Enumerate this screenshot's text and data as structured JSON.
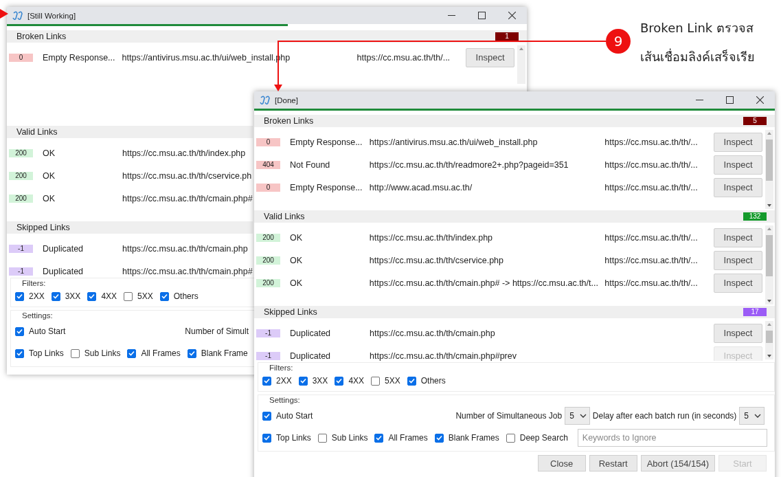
{
  "callout": {
    "number": "9",
    "lines": [
      "Broken Link ตรวจส",
      "เส้นเชื่อมลิงค์เสร็จเรีย"
    ]
  },
  "windows": [
    {
      "title": "[Still Working]",
      "progress": {
        "level": 0.54
      },
      "sections": [
        {
          "kind": "broken",
          "title": "Broken Links",
          "count": "1",
          "rows": [
            {
              "code": "0",
              "status": "Empty Response...",
              "url": "https://antivirus.msu.ac.th/ui/web_install.php",
              "referrer": "https://cc.msu.ac.th/th/...",
              "inspect": {
                "label": "Inspect",
                "disabled": false
              }
            }
          ]
        },
        {
          "kind": "valid",
          "title": "Valid Links",
          "rows": [
            {
              "code": "200",
              "status": "OK",
              "url": "https://cc.msu.ac.th/th/index.php"
            },
            {
              "code": "200",
              "status": "OK",
              "url": "https://cc.msu.ac.th/th/cservice.ph"
            },
            {
              "code": "200",
              "status": "OK",
              "url": "https://cc.msu.ac.th/th/cmain.php#"
            }
          ]
        },
        {
          "kind": "skipped",
          "title": "Skipped Links",
          "rows": [
            {
              "code": "-1",
              "status": "Duplicated",
              "url": "https://cc.msu.ac.th/th/cmain.php"
            },
            {
              "code": "-1",
              "status": "Duplicated",
              "url": "https://cc.msu.ac.th/th/cmain.php#"
            }
          ]
        }
      ],
      "filters": {
        "legend": "Filters:",
        "items": [
          {
            "label": "2XX",
            "checked": true
          },
          {
            "label": "3XX",
            "checked": true
          },
          {
            "label": "4XX",
            "checked": true
          },
          {
            "label": "5XX",
            "checked": false
          },
          {
            "label": "Others",
            "checked": true
          }
        ]
      },
      "settings": {
        "legend": "Settings:",
        "first_line": [
          {
            "kind": "checkbox",
            "label": "Auto Start",
            "checked": true
          },
          {
            "kind": "text",
            "label": "Number of Simult"
          }
        ],
        "second_line": [
          {
            "kind": "checkbox",
            "label": "Top Links",
            "checked": true
          },
          {
            "kind": "checkbox",
            "label": "Sub Links",
            "checked": false
          },
          {
            "kind": "checkbox",
            "label": "All Frames",
            "checked": true
          },
          {
            "kind": "checkbox",
            "label": "Blank Frame",
            "checked": true
          }
        ]
      }
    },
    {
      "title": "[Done]",
      "progress": {
        "level": 1
      },
      "sections": [
        {
          "kind": "broken",
          "title": "Broken Links",
          "count": "5",
          "rows": [
            {
              "code": "0",
              "status": "Empty Response...",
              "url": "https://antivirus.msu.ac.th/ui/web_install.php",
              "referrer": "https://cc.msu.ac.th/th/...",
              "inspect": {
                "label": "Inspect",
                "disabled": false
              }
            },
            {
              "code": "404",
              "status": "Not Found",
              "url": "https://cc.msu.ac.th/th/readmore2+.php?pageid=351",
              "referrer": "https://cc.msu.ac.th/th/...",
              "inspect": {
                "label": "Inspect",
                "disabled": false
              }
            },
            {
              "code": "0",
              "status": "Empty Response...",
              "url": "http://www.acad.msu.ac.th/",
              "referrer": "https://cc.msu.ac.th/th/...",
              "inspect": {
                "label": "Inspect",
                "disabled": false
              }
            }
          ]
        },
        {
          "kind": "valid",
          "title": "Valid Links",
          "count": "132",
          "rows": [
            {
              "code": "200",
              "status": "OK",
              "url": "https://cc.msu.ac.th/th/index.php",
              "referrer": "https://cc.msu.ac.th/th/...",
              "inspect": {
                "label": "Inspect",
                "disabled": false
              }
            },
            {
              "code": "200",
              "status": "OK",
              "url": "https://cc.msu.ac.th/th/cservice.php",
              "referrer": "https://cc.msu.ac.th/th/...",
              "inspect": {
                "label": "Inspect",
                "disabled": false
              }
            },
            {
              "code": "200",
              "status": "OK",
              "url": "https://cc.msu.ac.th/th/cmain.php# -> https://cc.msu.ac.th/t...",
              "referrer": "https://cc.msu.ac.th/th/...",
              "inspect": {
                "label": "Inspect",
                "disabled": false
              }
            }
          ]
        },
        {
          "kind": "skipped",
          "title": "Skipped Links",
          "count": "17",
          "rows": [
            {
              "code": "-1",
              "status": "Duplicated",
              "url": "https://cc.msu.ac.th/th/cmain.php",
              "inspect": {
                "label": "Inspect",
                "disabled": false
              }
            },
            {
              "code": "-1",
              "status": "Duplicated",
              "url": "https://cc.msu.ac.th/th/cmain.php#prev",
              "inspect": {
                "label": "Inspect",
                "disabled": true
              }
            }
          ]
        }
      ],
      "filters": {
        "legend": "Filters:",
        "items": [
          {
            "label": "2XX",
            "checked": true
          },
          {
            "label": "3XX",
            "checked": true
          },
          {
            "label": "4XX",
            "checked": true
          },
          {
            "label": "5XX",
            "checked": false
          },
          {
            "label": "Others",
            "checked": true
          }
        ]
      },
      "settings": {
        "legend": "Settings:",
        "first_line": [
          {
            "kind": "checkbox",
            "label": "Auto Start",
            "checked": true
          },
          {
            "kind": "select",
            "label": "Number of Simultaneous Job",
            "value": "5"
          },
          {
            "kind": "select",
            "label": "Delay after each batch run (in seconds)",
            "value": "5"
          }
        ],
        "second_line": [
          {
            "kind": "checkbox",
            "label": "Top Links",
            "checked": true
          },
          {
            "kind": "checkbox",
            "label": "Sub Links",
            "checked": false
          },
          {
            "kind": "checkbox",
            "label": "All Frames",
            "checked": true
          },
          {
            "kind": "checkbox",
            "label": "Blank Frames",
            "checked": true
          },
          {
            "kind": "checkbox",
            "label": "Deep Search",
            "checked": false
          },
          {
            "kind": "field",
            "placeholder": "Keywords to Ignore"
          }
        ]
      },
      "buttons": [
        {
          "label": "Close",
          "disabled": false
        },
        {
          "label": "Restart",
          "disabled": false
        },
        {
          "label": "Abort (154/154)",
          "disabled": false
        },
        {
          "label": "Start",
          "disabled": true
        }
      ]
    }
  ]
}
